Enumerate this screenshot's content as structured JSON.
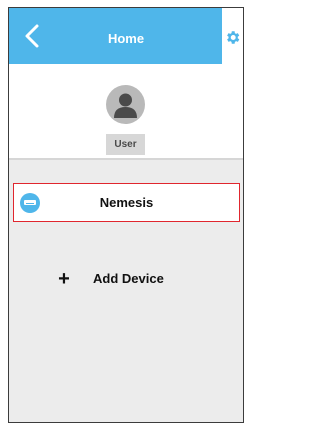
{
  "header": {
    "title": "Home",
    "back_icon": "chevron-left-icon",
    "settings_icon": "gear-icon",
    "color": "#4fb6ea"
  },
  "profile": {
    "avatar_icon": "user-avatar-icon",
    "user_label": "User"
  },
  "devices": [
    {
      "name": "Nemesis",
      "icon": "air-conditioner-icon",
      "selected": true,
      "highlight_color": "#e0262e"
    }
  ],
  "add_device": {
    "icon": "plus-icon",
    "label": "Add Device"
  }
}
